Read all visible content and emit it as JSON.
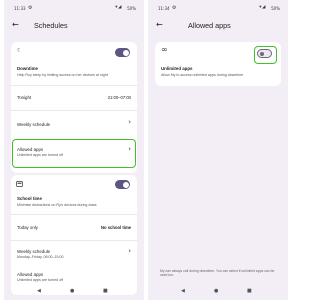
{
  "left": {
    "status_time": "11:33",
    "battery": "50%",
    "title": "Schedules",
    "downtime": {
      "label": "Downtime",
      "desc": "Help Roy sleep by limiting access on her devices at night",
      "enabled": true
    },
    "tonight": {
      "label": "Tonight",
      "value": "21:00–07:00"
    },
    "weekly_schedule": {
      "label": "Weekly schedule"
    },
    "allowed_apps": {
      "label": "Allowed apps",
      "sub": "Unlimited apps are turned off"
    },
    "school_time": {
      "label": "School time",
      "desc": "Minimise distractions on Ry's devices during class",
      "enabled": true
    },
    "today_only": {
      "label": "Today only",
      "value": "No school time"
    },
    "weekly_schedule2": {
      "label": "Weekly schedule",
      "sub": "Monday–Friday, 08:00–15:00"
    },
    "allowed_apps2": {
      "label": "Allowed apps",
      "sub": "Unlimited apps are turned off"
    }
  },
  "right": {
    "status_time": "11:34",
    "battery": "50%",
    "title": "Allowed apps",
    "unlimited": {
      "label": "Unlimited apps",
      "desc": "Allow My to access unlimited apps during downtime",
      "enabled": false
    },
    "footer": "My can always call during downtime. You can select if unlimited apps can be used too."
  },
  "icons": {
    "back": "←",
    "chevron": "›",
    "moon": "☾",
    "infinity": "∞",
    "gear": "⚙",
    "nav_back": "◀",
    "nav_home": "●",
    "nav_recent": "■"
  },
  "colors": {
    "background": "#f3eef6",
    "card": "#ffffff",
    "toggle_on": "#5d5680",
    "highlight": "#43c02b"
  }
}
